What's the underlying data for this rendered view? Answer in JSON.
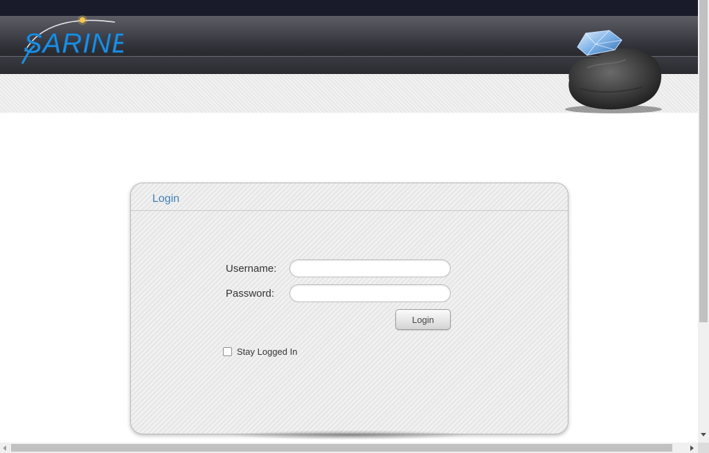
{
  "header": {
    "logo_text": "SARINE",
    "logo_icon": "sarine-logo",
    "decoration": "diamond-on-rock-image",
    "colors": {
      "topbar": "#191a2a",
      "header_dark": "#1e1f24",
      "logo_blue": "#1e8fe0"
    }
  },
  "login_panel": {
    "title": "Login",
    "username_label": "Username:",
    "username_value": "",
    "password_label": "Password:",
    "password_value": "",
    "login_button": "Login",
    "stay_logged_in_label": "Stay Logged In",
    "stay_logged_in_checked": false,
    "colors": {
      "title": "#3f7fb8"
    }
  },
  "scrollbars": {
    "vertical": true,
    "horizontal": true
  }
}
